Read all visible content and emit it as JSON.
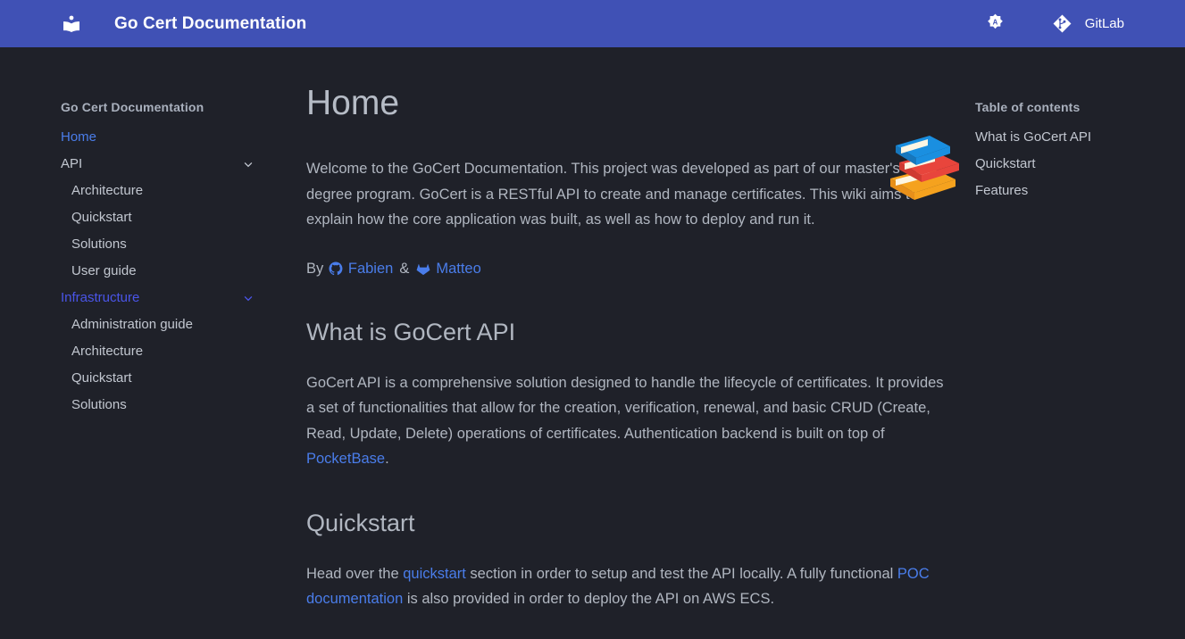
{
  "header": {
    "logo_icon": "book-reader-icon",
    "title": "Go Cert Documentation",
    "palette_toggle": {
      "icon": "brightness-auto-icon",
      "label": "Switch to light mode"
    },
    "repo": {
      "icon": "git-source-branch-icon",
      "label": "GitLab"
    },
    "background_color": "#4051b5"
  },
  "sidebar": {
    "root_title": "Go Cert Documentation",
    "items": [
      {
        "label": "Home",
        "state": "active",
        "expandable": false
      },
      {
        "label": "API",
        "state": "normal",
        "expandable": true,
        "children": [
          {
            "label": "Architecture"
          },
          {
            "label": "Quickstart"
          },
          {
            "label": "Solutions"
          },
          {
            "label": "User guide"
          }
        ]
      },
      {
        "label": "Infrastructure",
        "state": "hover",
        "expandable": true,
        "children": [
          {
            "label": "Administration guide"
          },
          {
            "label": "Architecture"
          },
          {
            "label": "Quickstart"
          },
          {
            "label": "Solutions"
          }
        ]
      }
    ]
  },
  "main": {
    "title": "Home",
    "hero_emoji": "books-emoji",
    "intro": "Welcome to the GoCert Documentation. This project was developed as part of our master's degree program. GoCert is a RESTful API to create and manage certificates. This wiki aims to explain how the core application was built, as well as how to deploy and run it.",
    "byline": {
      "prefix": "By",
      "author1": {
        "icon": "github-icon",
        "name": "Fabien"
      },
      "separator": "&",
      "author2": {
        "icon": "gitlab-icon",
        "name": "Matteo"
      }
    },
    "sections": [
      {
        "heading": "What is GoCert API",
        "paragraph_part1": "GoCert API is a comprehensive solution designed to handle the lifecycle of certificates. It provides a set of functionalities that allow for the creation, verification, renewal, and basic CRUD (Create, Read, Update, Delete) operations of certificates. Authentication backend is built on top of ",
        "link1": "PocketBase",
        "paragraph_part2": "."
      },
      {
        "heading": "Quickstart",
        "text_a": "Head over the ",
        "link_a": "quickstart",
        "text_b": " section in order to setup and test the API locally. A fully functional ",
        "link_b": "POC documentation",
        "text_c": " is also provided in order to deploy the API on AWS ECS."
      }
    ]
  },
  "toc": {
    "title": "Table of contents",
    "items": [
      {
        "label": "What is GoCert API"
      },
      {
        "label": "Quickstart"
      },
      {
        "label": "Features"
      }
    ]
  },
  "colors": {
    "header": "#4051b5",
    "background": "#1f2129",
    "link": "#4a7dea",
    "hover_link": "#4a55e8",
    "text": "#b0b6c0",
    "muted": "#a9b0bd"
  }
}
